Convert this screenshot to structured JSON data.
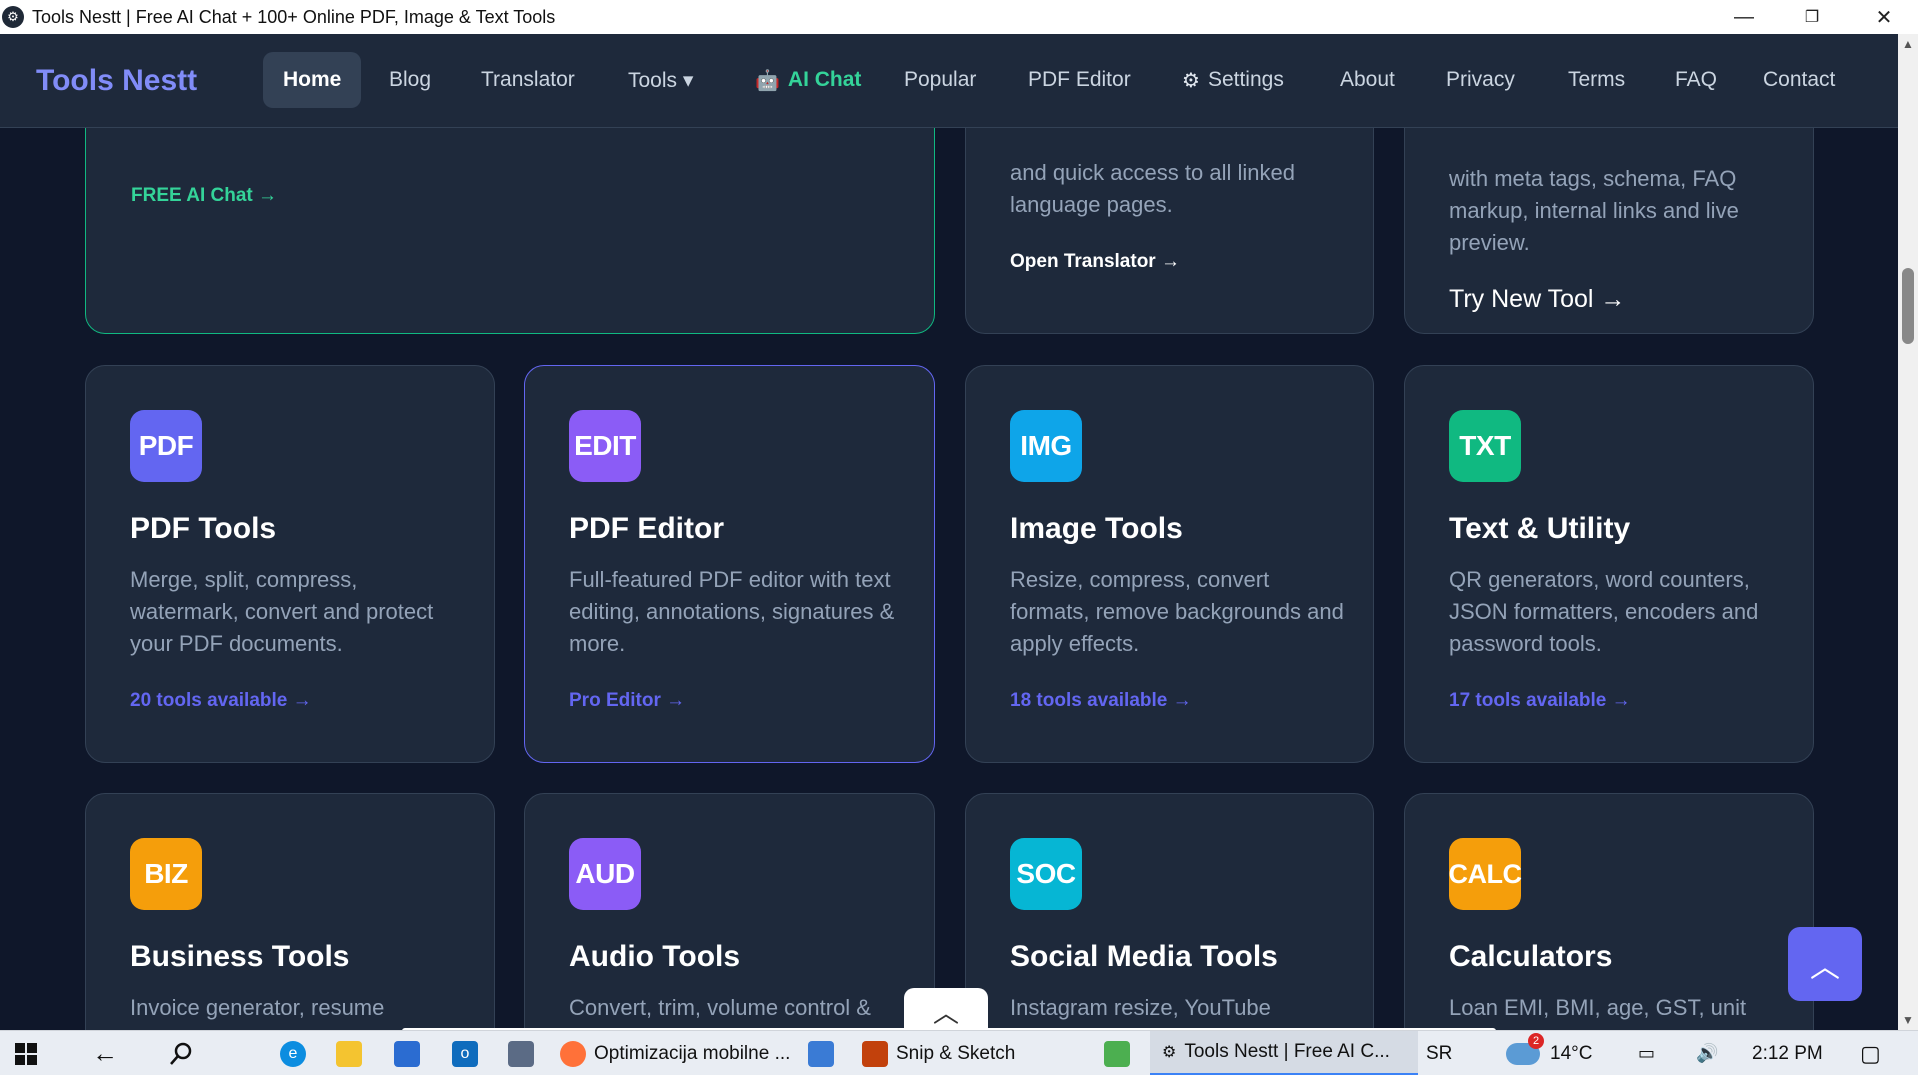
{
  "window": {
    "title": "Tools Nestt | Free AI Chat + 100+ Online PDF, Image & Text Tools",
    "minimize": "—",
    "maximize": "❐",
    "close": "✕"
  },
  "nav": {
    "brand": "Tools Nestt",
    "items": [
      {
        "label": "Home"
      },
      {
        "label": "Blog"
      },
      {
        "label": "Translator"
      },
      {
        "label": "Tools ▾"
      },
      {
        "label": "AI Chat",
        "icon": "🤖"
      },
      {
        "label": "Popular"
      },
      {
        "label": "PDF Editor"
      },
      {
        "label": "Settings",
        "icon": "⚙"
      },
      {
        "label": "About"
      },
      {
        "label": "Privacy"
      },
      {
        "label": "Terms"
      },
      {
        "label": "FAQ"
      },
      {
        "label": "Contact"
      }
    ]
  },
  "upper_cards": {
    "ai_chat": {
      "link": "FREE AI Chat →"
    },
    "translator": {
      "text": "and quick access to all linked language pages.",
      "link": "Open Translator →"
    },
    "new_tool": {
      "text": "with meta tags, schema, FAQ markup, internal links and live preview.",
      "link": "Try New Tool →"
    }
  },
  "cards": [
    {
      "badge": "PDF",
      "badge_color": "#6366f1",
      "title": "PDF Tools",
      "desc": "Merge, split, compress, watermark, convert and protect your PDF documents.",
      "link": "20 tools available →"
    },
    {
      "badge": "EDIT",
      "badge_color": "#8b5cf6",
      "title": "PDF Editor",
      "desc": "Full-featured PDF editor with text editing, annotations, signatures & more.",
      "link": "Pro Editor →"
    },
    {
      "badge": "IMG",
      "badge_color": "#0ea5e9",
      "title": "Image Tools",
      "desc": "Resize, compress, convert formats, remove backgrounds and apply effects.",
      "link": "18 tools available →"
    },
    {
      "badge": "TXT",
      "badge_color": "#10b981",
      "title": "Text & Utility",
      "desc": "QR generators, word counters, JSON formatters, encoders and password tools.",
      "link": "17 tools available →"
    },
    {
      "badge": "BIZ",
      "badge_color": "#f59e0b",
      "title": "Business Tools",
      "desc": "Invoice generator, resume"
    },
    {
      "badge": "AUD",
      "badge_color": "#8b5cf6",
      "title": "Audio Tools",
      "desc": "Convert, trim, volume control &"
    },
    {
      "badge": "SOC",
      "badge_color": "#06b6d4",
      "title": "Social Media Tools",
      "desc": "Instagram resize, YouTube"
    },
    {
      "badge": "CALC",
      "badge_color": "#f59e0b",
      "title": "Calculators",
      "desc": "Loan EMI, BMI, age, GST, unit"
    }
  ],
  "fab": "︿",
  "bottom_tab": "︿",
  "taskbar": {
    "items": [
      {
        "label": "Optimizacija mobilne ..."
      },
      {
        "label": "Snip & Sketch"
      },
      {
        "label": "Tools Nestt | Free AI C..."
      }
    ],
    "lang": "SR",
    "weather_badge": "2",
    "temperature": "14°C",
    "time": "2:12 PM"
  }
}
